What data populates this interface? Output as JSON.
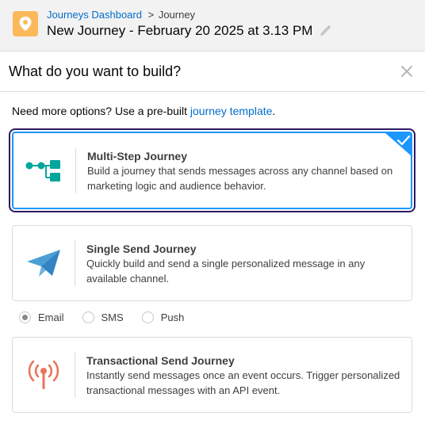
{
  "header": {
    "breadcrumb_link": "Journeys Dashboard",
    "breadcrumb_separator": ">",
    "breadcrumb_current": "Journey",
    "journey_name": "New Journey - February 20 2025 at 3.13 PM",
    "app_icon": "map-pin-icon",
    "edit_icon": "pencil-icon"
  },
  "modal": {
    "title": "What do you want to build?",
    "close_icon": "close-icon",
    "more_options_text": "Need more options? Use a pre-built ",
    "more_options_link": "journey template",
    "more_options_end": "."
  },
  "cards": {
    "multi_step": {
      "title": "Multi-Step Journey",
      "description": "Build a journey that sends messages across any channel based on marketing logic and audience behavior.",
      "icon": "flow-diagram-icon",
      "selected": true
    },
    "single_send": {
      "title": "Single Send Journey",
      "description": "Quickly build and send a single personalized message in any available channel.",
      "icon": "paper-plane-icon",
      "selected": false
    },
    "transactional": {
      "title": "Transactional Send Journey",
      "description": "Instantly send messages once an event occurs. Trigger personalized transactional messages with an API event.",
      "icon": "broadcast-antenna-icon",
      "selected": false
    }
  },
  "channels": {
    "options": [
      "Email",
      "SMS",
      "Push"
    ],
    "selected": "Email"
  },
  "colors": {
    "link": "#006dcc",
    "app_icon_bg": "#fcb95b",
    "selected_border": "#1b96ff",
    "selected_outline": "#2d1a63",
    "flow_icon": "#04a59a",
    "plane_icon": "#4b9fd5",
    "antenna_icon": "#e8755b"
  }
}
